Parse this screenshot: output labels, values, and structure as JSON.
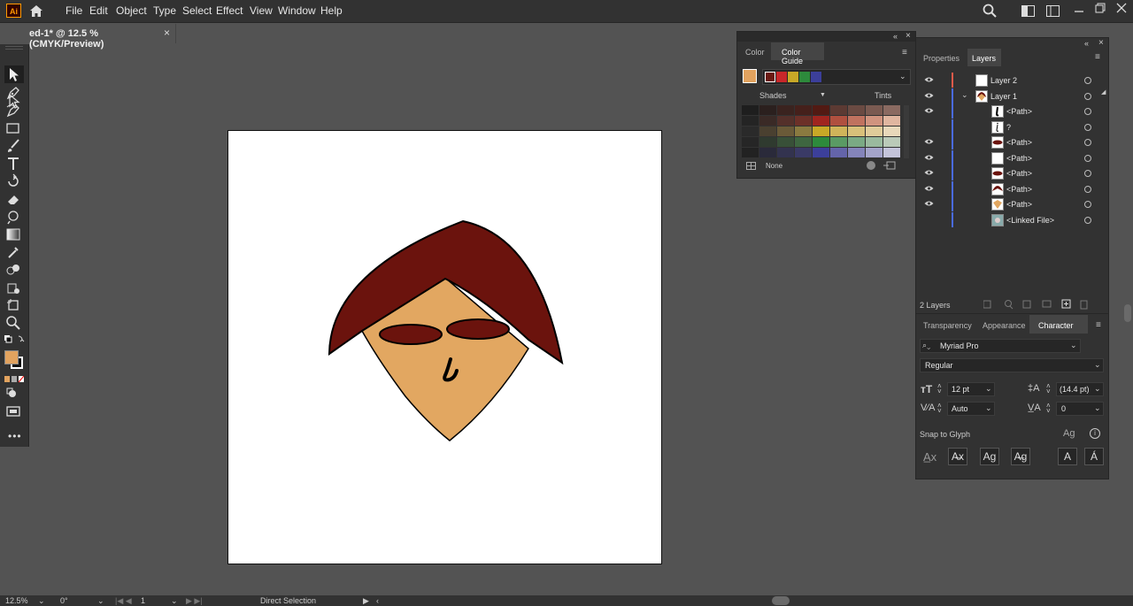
{
  "app": {
    "logo": "Ai"
  },
  "menu": [
    "File",
    "Edit",
    "Object",
    "Type",
    "Select",
    "Effect",
    "View",
    "Window",
    "Help"
  ],
  "document_tab": {
    "label": "ed-1* @ 12.5 % (CMYK/Preview)",
    "close": "×"
  },
  "color_panel": {
    "tabs": [
      "Color",
      "Color Guide"
    ],
    "shades_label": "Shades",
    "tints_label": "Tints",
    "none_label": "None",
    "harmony_colors": [
      "#6b1a12",
      "#c8272a",
      "#c8a827",
      "#2d8a3c",
      "#3c3f9a"
    ],
    "current_color": "#e2a35f",
    "grid_rows": [
      [
        "#1e1e1e",
        "#2b201e",
        "#3a231f",
        "#45201b",
        "#521a13",
        "#5c3a33",
        "#6a4a42",
        "#7a5a51",
        "#8a6a61"
      ],
      [
        "#242424",
        "#3a2a26",
        "#54302a",
        "#6c3028",
        "#a0251f",
        "#b0503f",
        "#c0725f",
        "#d0947f",
        "#e0b6a0"
      ],
      [
        "#2a2a2a",
        "#4a4030",
        "#6a5a38",
        "#8a7a40",
        "#c8a827",
        "#d0b45a",
        "#d8c07a",
        "#e0cc9a",
        "#e8d8ba"
      ],
      [
        "#262626",
        "#2f3a2f",
        "#385038",
        "#3e6640",
        "#2d8a3c",
        "#5a9a64",
        "#7aaa84",
        "#9aba9e",
        "#bacab8"
      ],
      [
        "#222222",
        "#2a2a3a",
        "#33334f",
        "#3a3a66",
        "#3c3f9a",
        "#6464aa",
        "#8484ba",
        "#a4a4ca",
        "#c4c4da"
      ]
    ]
  },
  "layers_panel": {
    "tabs": [
      "Properties",
      "Layers"
    ],
    "layers": [
      {
        "name": "Layer 2",
        "color": "#e05a4a",
        "visible": true,
        "thumb": "blank"
      },
      {
        "name": "Layer 1",
        "color": "#4a6be0",
        "visible": true,
        "thumb": "face"
      }
    ],
    "items": [
      {
        "name": "<Path>",
        "visible": true,
        "thumb": "nose"
      },
      {
        "name": "?",
        "visible": false,
        "thumb": "nose-outline"
      },
      {
        "name": "<Path>",
        "visible": true,
        "thumb": "eye"
      },
      {
        "name": "<Path>",
        "visible": true,
        "thumb": "blank"
      },
      {
        "name": "<Path>",
        "visible": true,
        "thumb": "eye"
      },
      {
        "name": "<Path>",
        "visible": true,
        "thumb": "hair"
      },
      {
        "name": "<Path>",
        "visible": true,
        "thumb": "head"
      },
      {
        "name": "<Linked File>",
        "visible": false,
        "thumb": "linked"
      }
    ],
    "count_label": "2 Layers"
  },
  "character_panel": {
    "tabs": [
      "Transparency",
      "Appearance",
      "Character"
    ],
    "font_family": "Myriad Pro",
    "font_style": "Regular",
    "font_size": "12 pt",
    "leading": "(14.4 pt)",
    "kerning": "Auto",
    "tracking": "0",
    "snap_label": "Snap to Glyph"
  },
  "status": {
    "zoom": "12.5%",
    "rotation": "0°",
    "artboard": "1",
    "tool": "Direct Selection"
  },
  "colors": {
    "hair": "#6b130d",
    "skin": "#e2a761",
    "eyes": "#6b130d",
    "fill_swatch": "#e2a35f"
  }
}
